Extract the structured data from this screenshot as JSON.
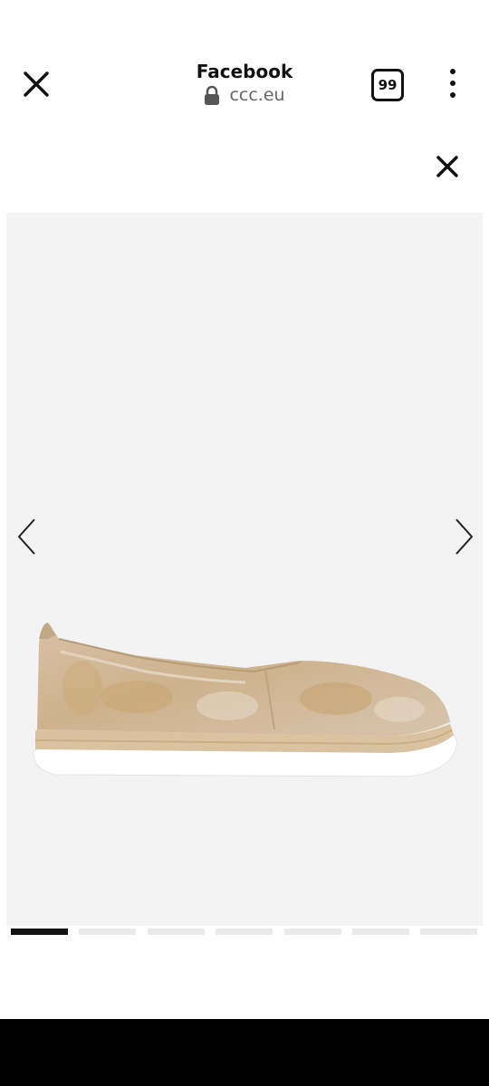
{
  "browser": {
    "title": "Facebook",
    "url": "ccc.eu",
    "tab_count": "99"
  },
  "gallery": {
    "total_slides": 7,
    "active_slide": 1,
    "product_color": "#d9c3a6"
  }
}
